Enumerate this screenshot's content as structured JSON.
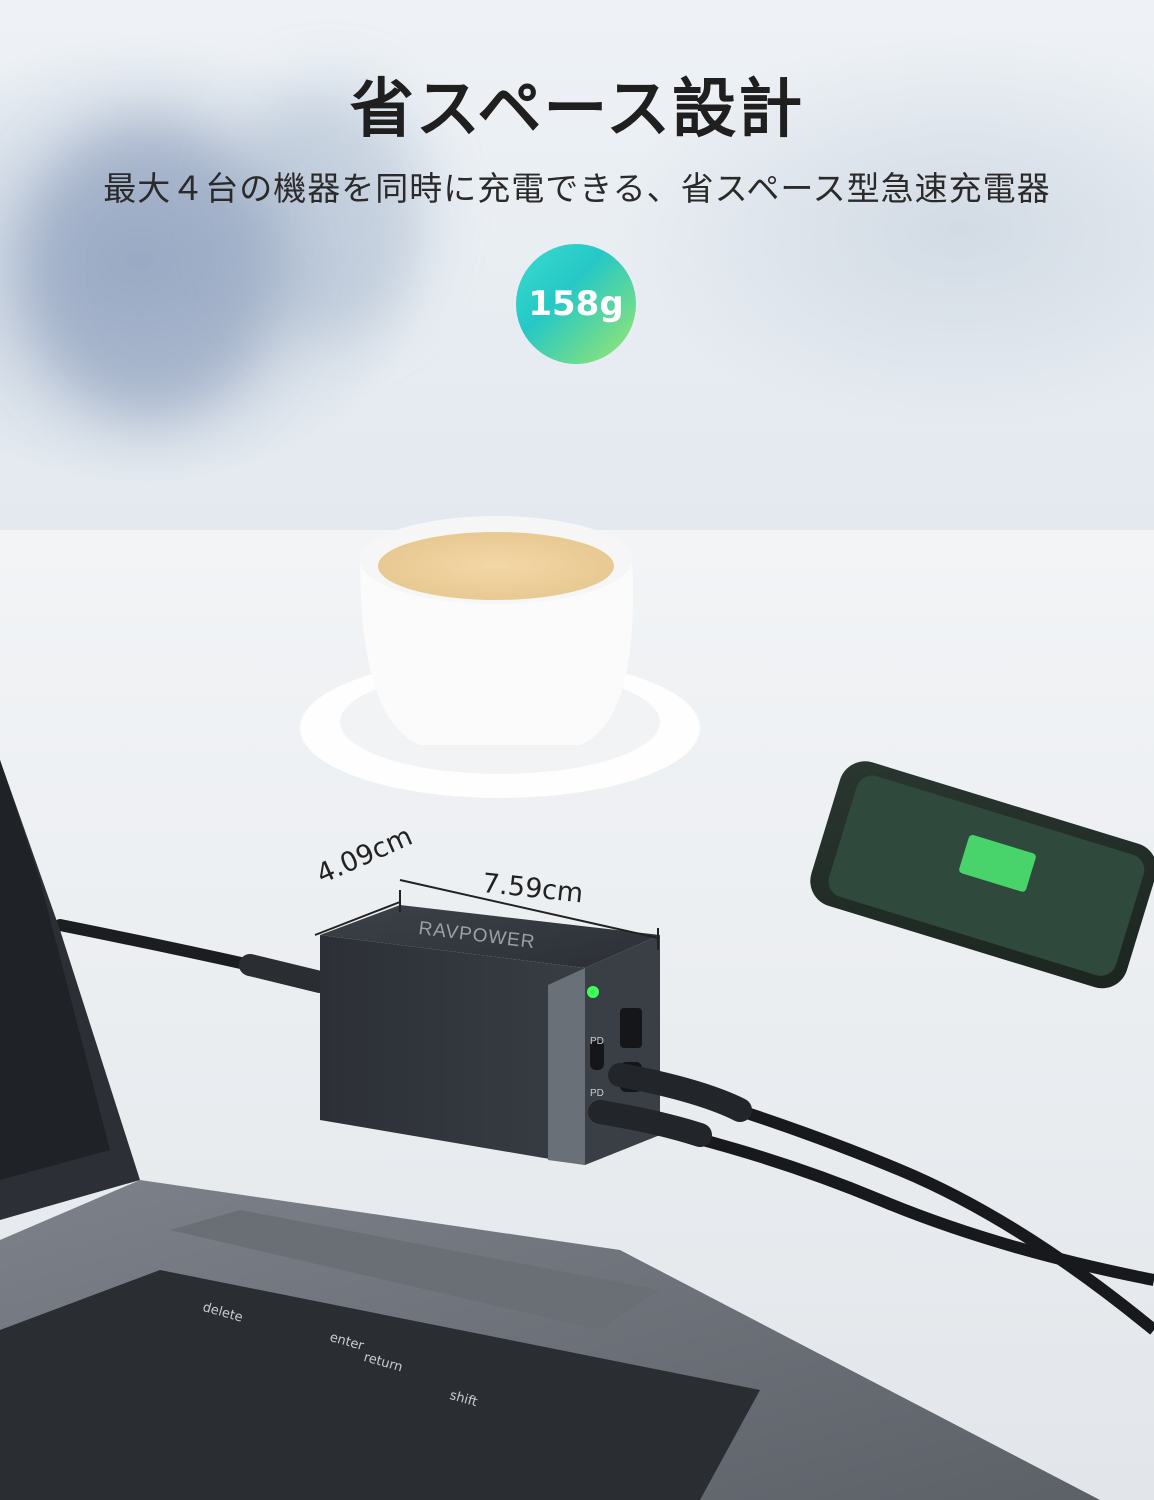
{
  "heading": {
    "title": "省スペース設計",
    "subtitle": "最大４台の機器を同時に充電できる、省スペース型急速充電器"
  },
  "badge": {
    "weight": "158g"
  },
  "dimensions": {
    "depth": "4.09cm",
    "width": "7.59cm"
  },
  "product": {
    "brand": "RAVPOWER",
    "port_label_1": "PD",
    "port_label_2": "PD"
  },
  "keyboard": {
    "key_delete": "delete",
    "key_enter": "enter",
    "key_return": "return",
    "key_shift": "shift"
  },
  "colors": {
    "accent_start": "#3ddbd0",
    "accent_end": "#9ee86b",
    "led": "#3cff5a"
  }
}
